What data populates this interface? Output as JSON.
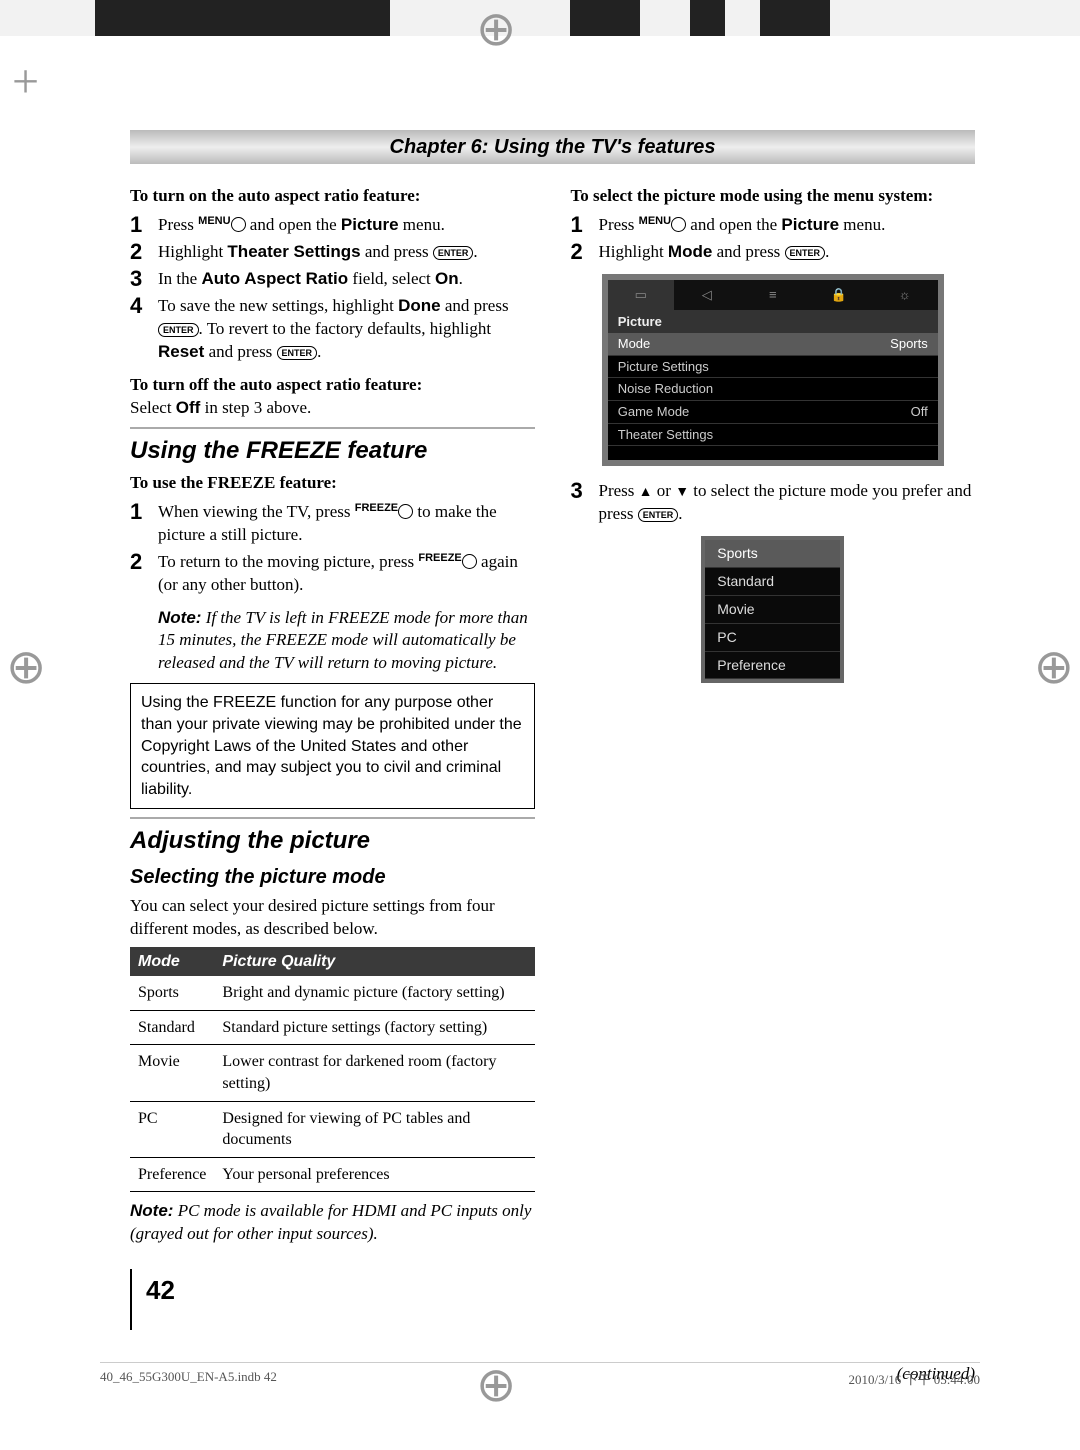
{
  "chapter": "Chapter 6: Using the TV's features",
  "left": {
    "h_auto_on": "To turn on the auto aspect ratio feature:",
    "s1": {
      "n": "1",
      "a": "Press ",
      "btn": "MENU",
      "b": " and open the ",
      "bold": "Picture",
      "c": " menu."
    },
    "s2": {
      "n": "2",
      "a": "Highlight ",
      "bold": "Theater Settings",
      "b": " and press ",
      "enter": "ENTER",
      "c": "."
    },
    "s3": {
      "n": "3",
      "a": "In the ",
      "bold": "Auto Aspect Ratio",
      "b": " field, select ",
      "bold2": "On",
      "c": "."
    },
    "s4": {
      "n": "4",
      "a": "To save the new settings, highlight ",
      "bold": "Done",
      "b": " and press ",
      "enter": "ENTER",
      "c": ". To revert to the factory defaults, highlight ",
      "bold2": "Reset",
      "d": " and press ",
      "enter2": "ENTER",
      "e": "."
    },
    "h_auto_off": "To turn off the auto aspect ratio feature:",
    "off_text_a": "Select ",
    "off_bold": "Off",
    "off_text_b": " in step 3 above.",
    "h_freeze": "Using the FREEZE feature",
    "h_freeze_use": "To use the FREEZE feature:",
    "f1": {
      "n": "1",
      "a": "When viewing the TV, press ",
      "btn": "FREEZE",
      "b": " to make the picture a still picture."
    },
    "f2": {
      "n": "2",
      "a": "To return to the moving picture, press ",
      "btn": "FREEZE",
      "b": " again (or any other button)."
    },
    "note_label": "Note:",
    "note_body": " If the TV is left in FREEZE mode for more than 15 minutes, the FREEZE mode will automatically be released and the TV will return to moving picture.",
    "warn": "Using the FREEZE function for any purpose other than your private viewing may be prohibited under the Copyright Laws of the United States and other countries, and may subject you to civil and criminal liability.",
    "h_adjust": "Adjusting the picture",
    "h_select": "Selecting the picture mode",
    "select_body": "You can select your desired picture settings from four different modes, as described below.",
    "th_mode": "Mode",
    "th_pq": "Picture Quality",
    "rows": [
      {
        "m": "Sports",
        "d": "Bright and dynamic picture (factory setting)"
      },
      {
        "m": "Standard",
        "d": "Standard picture settings (factory setting)"
      },
      {
        "m": "Movie",
        "d": "Lower contrast for darkened room (factory setting)"
      },
      {
        "m": "PC",
        "d": "Designed for viewing of PC tables and documents"
      },
      {
        "m": "Preference",
        "d": "Your personal preferences"
      }
    ],
    "note2_label": "Note:",
    "note2_body": " PC mode is available for HDMI and PC inputs only (grayed out for other input sources)."
  },
  "right": {
    "h_select": "To select the picture mode using the menu system:",
    "r1": {
      "n": "1",
      "a": "Press ",
      "btn": "MENU",
      "b": " and open the ",
      "bold": "Picture",
      "c": " menu."
    },
    "r2": {
      "n": "2",
      "a": "Highlight ",
      "bold": "Mode",
      "b": " and press ",
      "enter": "ENTER",
      "c": "."
    },
    "osd": {
      "hdr": "Picture",
      "rows": [
        {
          "l": "Mode",
          "v": "Sports",
          "hi": true
        },
        {
          "l": "Picture Settings",
          "v": ""
        },
        {
          "l": "Noise Reduction",
          "v": ""
        },
        {
          "l": "Game Mode",
          "v": "Off"
        },
        {
          "l": "Theater Settings",
          "v": ""
        }
      ]
    },
    "r3": {
      "n": "3",
      "a": "Press ",
      "up": "▲",
      "b": " or ",
      "down": "▼",
      "c": " to select the picture mode you prefer and press ",
      "enter": "ENTER",
      "d": "."
    },
    "modes": [
      "Sports",
      "Standard",
      "Movie",
      "PC",
      "Preference"
    ],
    "continued": "(continued)"
  },
  "pagenum": "42",
  "footer_left": "40_46_55G300U_EN-A5.indb   42",
  "footer_right": "2010/3/16   下午 05:44:00"
}
